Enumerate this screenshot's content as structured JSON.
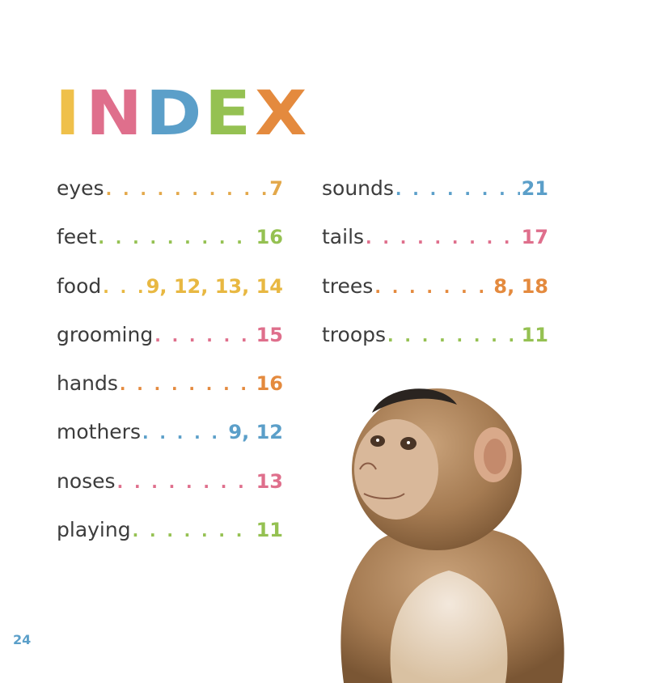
{
  "title": {
    "letters": [
      "I",
      "N",
      "D",
      "E",
      "X"
    ],
    "colors": [
      "#efc04a",
      "#df6f8c",
      "#5b9fc9",
      "#95c152",
      "#e48a3e"
    ]
  },
  "index": {
    "left": [
      {
        "term": "eyes",
        "pages": "7",
        "color": "#e3a84a"
      },
      {
        "term": "feet",
        "pages": "16",
        "color": "#95c152"
      },
      {
        "term": "food",
        "pages": "9, 12, 13, 14",
        "color": "#e8b842"
      },
      {
        "term": "grooming",
        "pages": "15",
        "color": "#df6f8c"
      },
      {
        "term": "hands",
        "pages": "16",
        "color": "#e48a3e"
      },
      {
        "term": "mothers",
        "pages": "9, 12",
        "color": "#5b9fc9"
      },
      {
        "term": "noses",
        "pages": "13",
        "color": "#df6f8c"
      },
      {
        "term": "playing",
        "pages": "11",
        "color": "#95c152"
      }
    ],
    "right": [
      {
        "term": "sounds",
        "pages": "21",
        "color": "#5b9fc9"
      },
      {
        "term": "tails",
        "pages": "17",
        "color": "#df6f8c"
      },
      {
        "term": "trees",
        "pages": "8, 18",
        "color": "#e48a3e"
      },
      {
        "term": "troops",
        "pages": "11",
        "color": "#95c152"
      }
    ]
  },
  "page_number": "24"
}
